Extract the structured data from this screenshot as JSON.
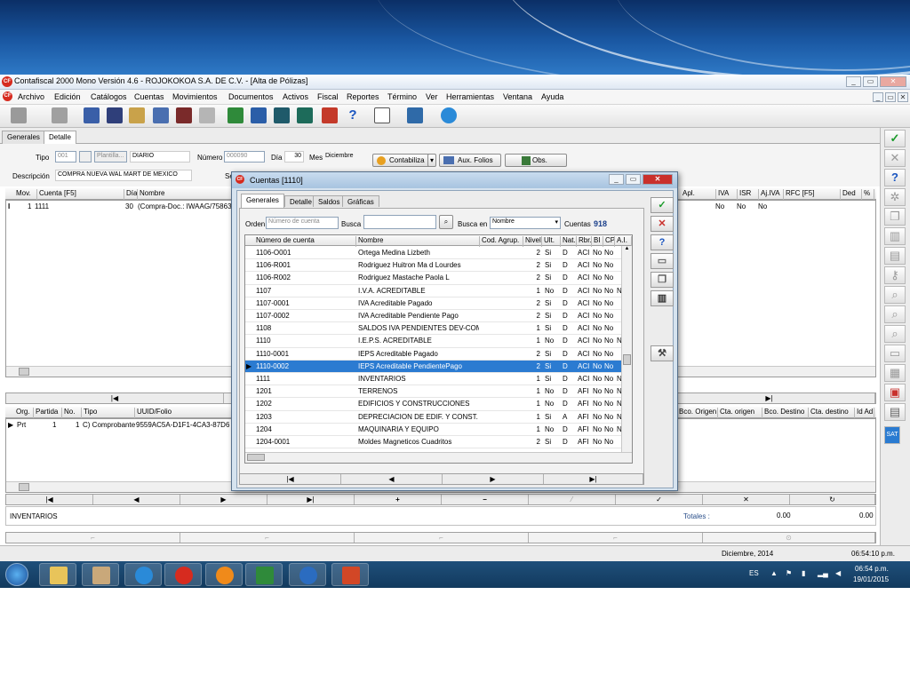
{
  "window": {
    "title": "Contafiscal 2000 Mono Versión 4.6 - ROJOKOKOA S.A. DE C.V. - [Alta de Pólizas]",
    "logo": "CF"
  },
  "menu": [
    "Archivo",
    "Edición",
    "Catálogos",
    "Cuentas",
    "Movimientos",
    "Documentos",
    "Activos",
    "Fiscal",
    "Reportes",
    "Término",
    "Ver",
    "Herramientas",
    "Ventana",
    "Ayuda"
  ],
  "tabs": {
    "generales": "Generales",
    "detalle": "Detalle"
  },
  "form": {
    "tipo_label": "Tipo",
    "tipo_value": "001",
    "plantilla_label": "Plantilla...",
    "tipo_name": "DIARIO",
    "numero_label": "Número",
    "numero_value": "000090",
    "dia_label": "Día",
    "dia_value": "30",
    "mes_label": "Mes",
    "mes_value": "Diciembre",
    "contabiliza_label": "Contabiliza",
    "aux_folios_label": "Aux. Folios",
    "obs_label": "Obs.",
    "descripcion_label": "Descripción",
    "descripcion_value": "COMPRA NUEVA WAL MART DE MEXICO",
    "se_label": "Se"
  },
  "mov_grid": {
    "headers": [
      "Mov.",
      "Cuenta   [F5]",
      "Día",
      "Nombre",
      "Apl.",
      "IVA",
      "ISR",
      "Aj.IVA",
      "RFC  [F5]",
      "Ded",
      "%"
    ],
    "row": {
      "mov": "1",
      "cuenta": "1111",
      "dia": "30",
      "nombre": "(Compra-Doc.: IWAAG/75863",
      "iva": "No",
      "isr": "No",
      "ajiva": "No"
    }
  },
  "doc_grid": {
    "headers": [
      "Org.",
      "Partida",
      "No.",
      "Tipo",
      "UUID/Folio"
    ],
    "right_headers": [
      "Bco. Origen",
      "Cta. origen",
      "Bco. Destino",
      "Cta. destino",
      "Id Ad"
    ],
    "row": {
      "org": "Prt",
      "partida": "1",
      "no": "1",
      "tipo": "C) Comprobante",
      "uuid": "9559AC5A-D1F1-4CA3-87D6"
    }
  },
  "summary": {
    "account_name": "INVENTARIOS",
    "totales_label": "Totales :",
    "total1": "0.00",
    "total2": "0.00"
  },
  "status": {
    "period": "Diciembre, 2014",
    "time": "06:54:10 p.m."
  },
  "taskbar": {
    "lang": "ES",
    "clock_time": "06:54 p.m.",
    "clock_date": "19/01/2015"
  },
  "dialog": {
    "title": "Cuentas [1110]",
    "tabs": [
      "Generales",
      "Detalle",
      "Saldos",
      "Gráficas"
    ],
    "orden_label": "Orden",
    "orden_value": "Número de cuenta",
    "busca_label": "Busca",
    "busca_en_label": "Busca en",
    "busca_en_value": "Nombre",
    "cuentas_label": "Cuentas",
    "cuentas_count": "918",
    "columns": [
      "Número de cuenta",
      "Nombre",
      "Cod. Agrup.",
      "Nivel",
      "Ult.",
      "Nat.",
      "Rbr.",
      "BI",
      "CP",
      "A.I."
    ],
    "rows": [
      {
        "num": "1106-O001",
        "name": "Ortega Medina Lizbeth",
        "cod": "",
        "nivel": "2",
        "ult": "Si",
        "nat": "D",
        "rbr": "ACI",
        "bi": "No",
        "cp": "No",
        "ai": ""
      },
      {
        "num": "1106-R001",
        "name": "Rodriguez Huitron Ma d Lourdes",
        "cod": "",
        "nivel": "2",
        "ult": "Si",
        "nat": "D",
        "rbr": "ACI",
        "bi": "No",
        "cp": "No",
        "ai": ""
      },
      {
        "num": "1106-R002",
        "name": "Rodriguez Mastache Paola L",
        "cod": "",
        "nivel": "2",
        "ult": "Si",
        "nat": "D",
        "rbr": "ACI",
        "bi": "No",
        "cp": "No",
        "ai": ""
      },
      {
        "num": "1107",
        "name": "I.V.A. ACREDITABLE",
        "cod": "",
        "nivel": "1",
        "ult": "No",
        "nat": "D",
        "rbr": "ACI",
        "bi": "No",
        "cp": "No",
        "ai": "N"
      },
      {
        "num": "1107-0001",
        "name": "IVA Acreditable Pagado",
        "cod": "",
        "nivel": "2",
        "ult": "Si",
        "nat": "D",
        "rbr": "ACI",
        "bi": "No",
        "cp": "No",
        "ai": ""
      },
      {
        "num": "1107-0002",
        "name": "IVA Acreditable Pendiente Pago",
        "cod": "",
        "nivel": "2",
        "ult": "Si",
        "nat": "D",
        "rbr": "ACI",
        "bi": "No",
        "cp": "No",
        "ai": ""
      },
      {
        "num": "1108",
        "name": "SALDOS IVA PENDIENTES DEV-COMP",
        "cod": "",
        "nivel": "1",
        "ult": "Si",
        "nat": "D",
        "rbr": "ACI",
        "bi": "No",
        "cp": "No",
        "ai": ""
      },
      {
        "num": "1110",
        "name": "I.E.P.S. ACREDITABLE",
        "cod": "",
        "nivel": "1",
        "ult": "No",
        "nat": "D",
        "rbr": "ACI",
        "bi": "No",
        "cp": "No",
        "ai": "N"
      },
      {
        "num": "1110-0001",
        "name": "IEPS Acreditable Pagado",
        "cod": "",
        "nivel": "2",
        "ult": "Si",
        "nat": "D",
        "rbr": "ACI",
        "bi": "No",
        "cp": "No",
        "ai": ""
      },
      {
        "num": "1110-0002",
        "name": "IEPS Acreditable PendientePago",
        "cod": "",
        "nivel": "2",
        "ult": "Si",
        "nat": "D",
        "rbr": "ACI",
        "bi": "No",
        "cp": "No",
        "ai": ""
      },
      {
        "num": "1111",
        "name": "INVENTARIOS",
        "cod": "",
        "nivel": "1",
        "ult": "Si",
        "nat": "D",
        "rbr": "ACI",
        "bi": "No",
        "cp": "No",
        "ai": "N"
      },
      {
        "num": "1201",
        "name": "TERRENOS",
        "cod": "",
        "nivel": "1",
        "ult": "No",
        "nat": "D",
        "rbr": "AFI",
        "bi": "No",
        "cp": "No",
        "ai": "N"
      },
      {
        "num": "1202",
        "name": "EDIFICIOS Y CONSTRUCCIONES",
        "cod": "",
        "nivel": "1",
        "ult": "No",
        "nat": "D",
        "rbr": "AFI",
        "bi": "No",
        "cp": "No",
        "ai": "N"
      },
      {
        "num": "1203",
        "name": "DEPRECIACION DE EDIF. Y CONST.",
        "cod": "",
        "nivel": "1",
        "ult": "Si",
        "nat": "A",
        "rbr": "AFI",
        "bi": "No",
        "cp": "No",
        "ai": "N"
      },
      {
        "num": "1204",
        "name": "MAQUINARIA Y EQUIPO",
        "cod": "",
        "nivel": "1",
        "ult": "No",
        "nat": "D",
        "rbr": "AFI",
        "bi": "No",
        "cp": "No",
        "ai": "N"
      },
      {
        "num": "1204-0001",
        "name": "Moldes Magneticos Cuadritos",
        "cod": "",
        "nivel": "2",
        "ult": "Si",
        "nat": "D",
        "rbr": "AFI",
        "bi": "No",
        "cp": "No",
        "ai": ""
      }
    ]
  },
  "colors": {
    "selection": "#2b7bd1",
    "title_gradient": "#a8c4e0",
    "close_red": "#c9302c",
    "check_green": "#1a9b2a"
  }
}
